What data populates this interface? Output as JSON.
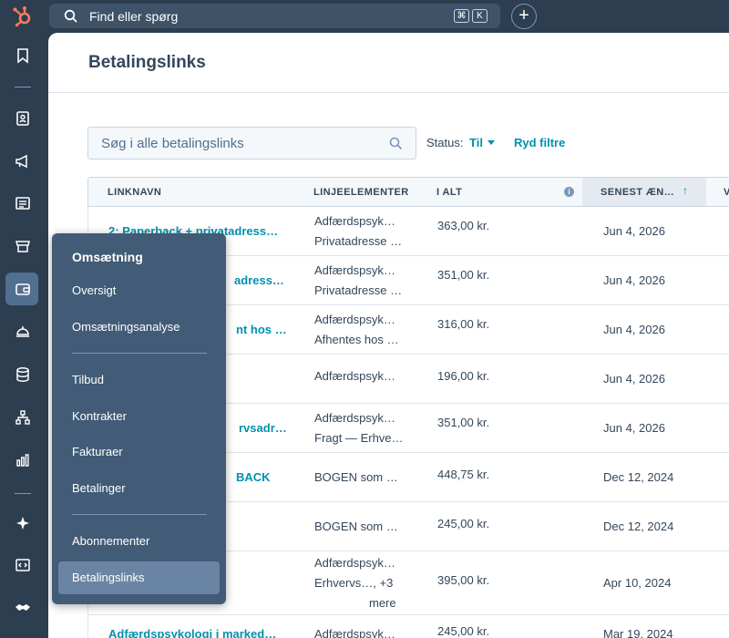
{
  "topbar": {
    "search_placeholder": "Find eller spørg",
    "shortcut_keys": [
      "⌘",
      "K"
    ],
    "add_label": "+"
  },
  "page": {
    "title": "Betalingslinks",
    "search_placeholder": "Søg i alle betalingslinks",
    "status_label": "Status:",
    "status_value": "Til",
    "clear_filters": "Ryd filtre"
  },
  "table": {
    "headers": [
      "LINKNAVN",
      "LINJEELEMENTER",
      "I ALT",
      "SENEST ÆN…",
      "V"
    ],
    "rows": [
      {
        "name": "2: Paperback + privatadress…",
        "items": [
          "Adfærdspsyk…",
          "Privatadresse …"
        ],
        "total": "363,00 kr.",
        "date": "Jun 4, 2026"
      },
      {
        "name": "adress…",
        "items": [
          "Adfærdspsyk…",
          "Privatadresse …"
        ],
        "total": "351,00 kr.",
        "date": "Jun 4, 2026"
      },
      {
        "name": "nt hos …",
        "items": [
          "Adfærdspsyk…",
          "Afhentes hos …"
        ],
        "total": "316,00 kr.",
        "date": "Jun 4, 2026"
      },
      {
        "name": "",
        "items": [
          "Adfærdspsyk…"
        ],
        "total": "196,00 kr.",
        "date": "Jun 4, 2026"
      },
      {
        "name": "rvsadr…",
        "items": [
          "Adfærdspsyk…",
          "Fragt — Erhve…"
        ],
        "total": "351,00 kr.",
        "date": "Jun 4, 2026"
      },
      {
        "name": "BACK",
        "items": [
          "BOGEN som …"
        ],
        "total": "448,75 kr.",
        "date": "Dec 12, 2024"
      },
      {
        "name": "",
        "items": [
          "BOGEN som …"
        ],
        "total": "245,00 kr.",
        "date": "Dec 12, 2024"
      },
      {
        "name": "",
        "items": [
          "Adfærdspsyk…",
          "Erhvervs…, +3",
          "mere"
        ],
        "total": "395,00 kr.",
        "date": "Apr 10, 2024"
      },
      {
        "name": "Adfærdspsykologi i marked…",
        "items": [
          "Adfærdspsyk…"
        ],
        "total": "245,00 kr.",
        "date": "Mar 19, 2024"
      }
    ]
  },
  "flyout": {
    "title": "Omsætning",
    "items": [
      {
        "label": "Oversigt"
      },
      {
        "label": "Omsætningsanalyse"
      },
      {
        "label": "Tilbud"
      },
      {
        "label": "Kontrakter"
      },
      {
        "label": "Fakturaer"
      },
      {
        "label": "Betalinger"
      },
      {
        "label": "Abonnementer"
      },
      {
        "label": "Betalingslinks",
        "active": true
      }
    ]
  },
  "colors": {
    "nav_bg": "#2d3e50",
    "flyout_bg": "#425b76",
    "link": "#0091ae",
    "brand_orange": "#ff7a59"
  }
}
